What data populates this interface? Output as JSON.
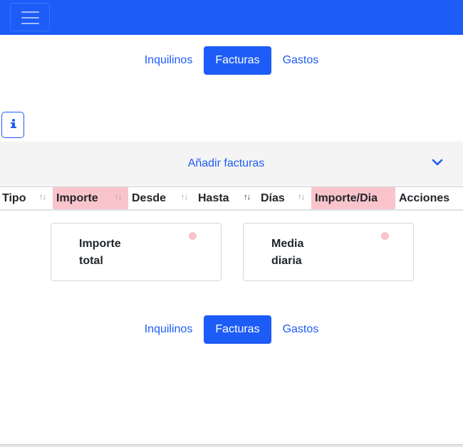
{
  "navbar": {
    "toggle_icon": "hamburger-icon",
    "background": "#1d5cf6"
  },
  "nav_pills": [
    {
      "label": "Inquilinos",
      "active": false
    },
    {
      "label": "Facturas",
      "active": true
    },
    {
      "label": "Gastos",
      "active": false
    }
  ],
  "info_button": {
    "icon": "info-icon"
  },
  "accordion": {
    "title": "Añadir facturas",
    "icon": "chevron-down-icon"
  },
  "table": {
    "columns": [
      {
        "label": "Tipo",
        "sort": "↑↓",
        "highlight": false
      },
      {
        "label": "Importe",
        "sort": "↑↓",
        "highlight": true
      },
      {
        "label": "Desde",
        "sort": "↑↓",
        "highlight": false
      },
      {
        "label": "Hasta",
        "sort": "↑↓",
        "highlight": false
      },
      {
        "label": "Días",
        "sort": "↑↓",
        "highlight": false
      },
      {
        "label": "Importe/Dia",
        "sort": "",
        "highlight": true
      },
      {
        "label": "Acciones",
        "sort": "",
        "highlight": false
      }
    ]
  },
  "summary_cards": [
    {
      "label": "Importe total",
      "marker_color": "#f9c4cb"
    },
    {
      "label": "Media diaria",
      "marker_color": "#f9c4cb"
    }
  ],
  "colors": {
    "primary": "#1d5cf6",
    "highlight": "#f9c4cb",
    "accordion_bg": "#f4f4f4"
  }
}
